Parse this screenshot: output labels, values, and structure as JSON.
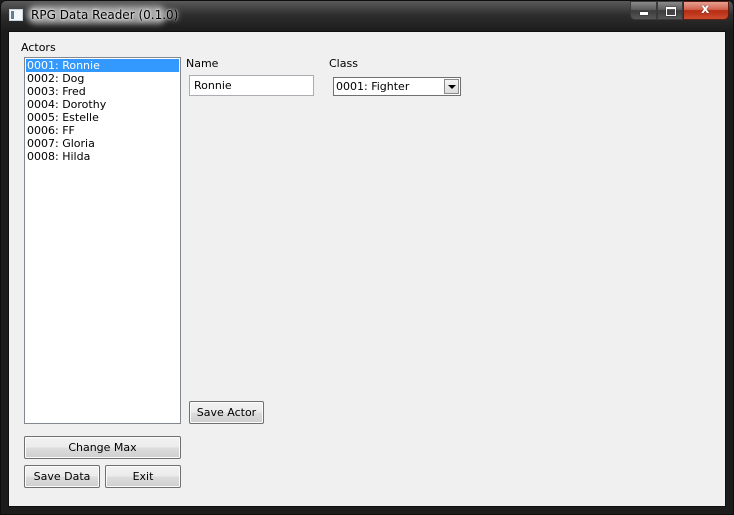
{
  "window": {
    "title": "RPG Data Reader (0.1.0)",
    "caption_icons": [
      "minimize-icon",
      "maximize-icon",
      "close-icon"
    ],
    "close_glyph": "x"
  },
  "actors": {
    "label": "Actors",
    "items": [
      "0001: Ronnie",
      "0002: Dog",
      "0003: Fred",
      "0004: Dorothy",
      "0005: Estelle",
      "0006: FF",
      "0007: Gloria",
      "0008: Hilda"
    ],
    "selected_index": 0
  },
  "form": {
    "name_label": "Name",
    "name_value": "Ronnie",
    "class_label": "Class",
    "class_value": "0001: Fighter",
    "save_actor_label": "Save Actor"
  },
  "buttons": {
    "change_max": "Change Max",
    "save_data": "Save Data",
    "exit": "Exit"
  },
  "colors": {
    "selection": "#3399ff",
    "client_bg": "#f0f0f0",
    "close_button": "#c7452b"
  }
}
